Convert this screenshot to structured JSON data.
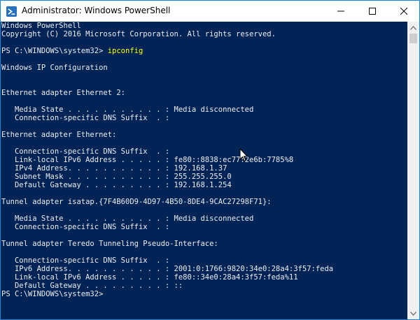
{
  "window": {
    "title": "Administrator: Windows PowerShell"
  },
  "icons": {
    "app": "powershell-icon",
    "minimize": "minimize-icon",
    "maximize": "maximize-icon",
    "close": "close-icon",
    "scroll_up": "chevron-up-icon",
    "scroll_down": "chevron-down-icon",
    "pointer": "mouse-pointer-icon"
  },
  "colors": {
    "console_bg": "#012456",
    "console_text": "#eeedf0",
    "command_text": "#ffff00",
    "window_border": "#1883d7"
  },
  "console": {
    "banner": "Windows PowerShell",
    "copyright": "Copyright (C) 2016 Microsoft Corporation. All rights reserved.",
    "prompt": "PS C:\\WINDOWS\\system32> ",
    "command": "ipconfig",
    "ip_config_header": "Windows IP Configuration",
    "adapters": [
      {
        "header": "Ethernet adapter Ethernet 2:",
        "lines": [
          "   Media State . . . . . . . . . . . : Media disconnected",
          "   Connection-specific DNS Suffix  . :"
        ]
      },
      {
        "header": "Ethernet adapter Ethernet:",
        "lines": [
          "   Connection-specific DNS Suffix  . :",
          "   Link-local IPv6 Address . . . . . : fe80::8838:ec77:2e6b:7785%8",
          "   IPv4 Address. . . . . . . . . . . : 192.168.1.37",
          "   Subnet Mask . . . . . . . . . . . : 255.255.255.0",
          "   Default Gateway . . . . . . . . . : 192.168.1.254"
        ]
      },
      {
        "header": "Tunnel adapter isatap.{7F4B60D9-4D97-4B50-8DE4-9CAC27298F71}:",
        "lines": [
          "   Media State . . . . . . . . . . . : Media disconnected",
          "   Connection-specific DNS Suffix  . :"
        ]
      },
      {
        "header": "Tunnel adapter Teredo Tunneling Pseudo-Interface:",
        "lines": [
          "   Connection-specific DNS Suffix  . :",
          "   IPv6 Address. . . . . . . . . . . : 2001:0:1766:9820:34e0:28a4:3f57:feda",
          "   Link-local IPv6 Address . . . . . : fe80::34e0:28a4:3f57:feda%11",
          "   Default Gateway . . . . . . . . . : ::"
        ]
      }
    ],
    "final_prompt": "PS C:\\WINDOWS\\system32>"
  }
}
